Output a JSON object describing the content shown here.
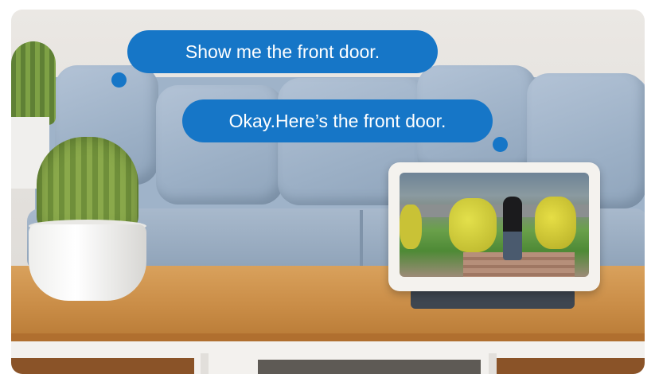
{
  "bubbles": {
    "user_query": "Show me the front door.",
    "assistant_reply": "Okay.Here’s the front door."
  },
  "colors": {
    "bubble_blue": "#1676c7",
    "sofa_blue": "#9fb3c9",
    "table_wood": "#c98c46"
  },
  "scene": {
    "icons": [
      "cactus-plant",
      "smart-display",
      "sofa",
      "wooden-table"
    ]
  }
}
